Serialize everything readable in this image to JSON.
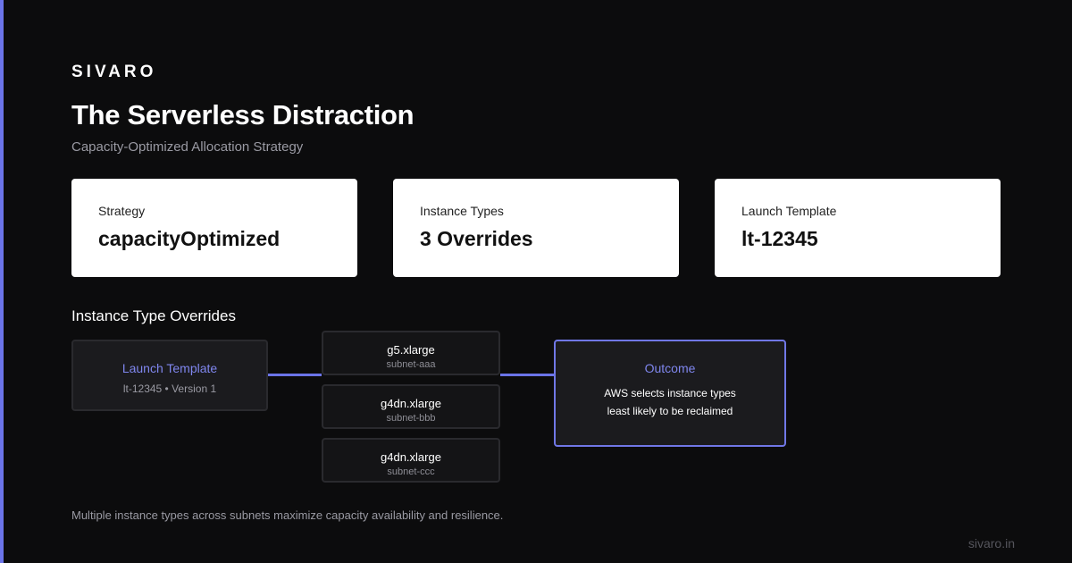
{
  "brand": "SIVARO",
  "title": "The Serverless Distraction",
  "subtitle": "Capacity-Optimized Allocation Strategy",
  "cards": [
    {
      "label": "Strategy",
      "value": "capacityOptimized"
    },
    {
      "label": "Instance Types",
      "value": "3 Overrides"
    },
    {
      "label": "Launch Template",
      "value": "lt-12345"
    }
  ],
  "section_heading": "Instance Type Overrides",
  "diagram": {
    "launch_template": {
      "title": "Launch Template",
      "subtitle": "lt-12345 • Version 1"
    },
    "overrides": [
      {
        "type": "g5.xlarge",
        "subnet": "subnet-aaa"
      },
      {
        "type": "g4dn.xlarge",
        "subnet": "subnet-bbb"
      },
      {
        "type": "g4dn.xlarge",
        "subnet": "subnet-ccc"
      }
    ],
    "outcome": {
      "title": "Outcome",
      "text": "AWS selects instance types least likely to be reclaimed"
    }
  },
  "footer_note": "Multiple instance types across subnets maximize capacity availability and resilience.",
  "site": "sivaro.in",
  "colors": {
    "accent": "#6b74e8",
    "background": "#0c0c0d",
    "card": "#ffffff"
  }
}
